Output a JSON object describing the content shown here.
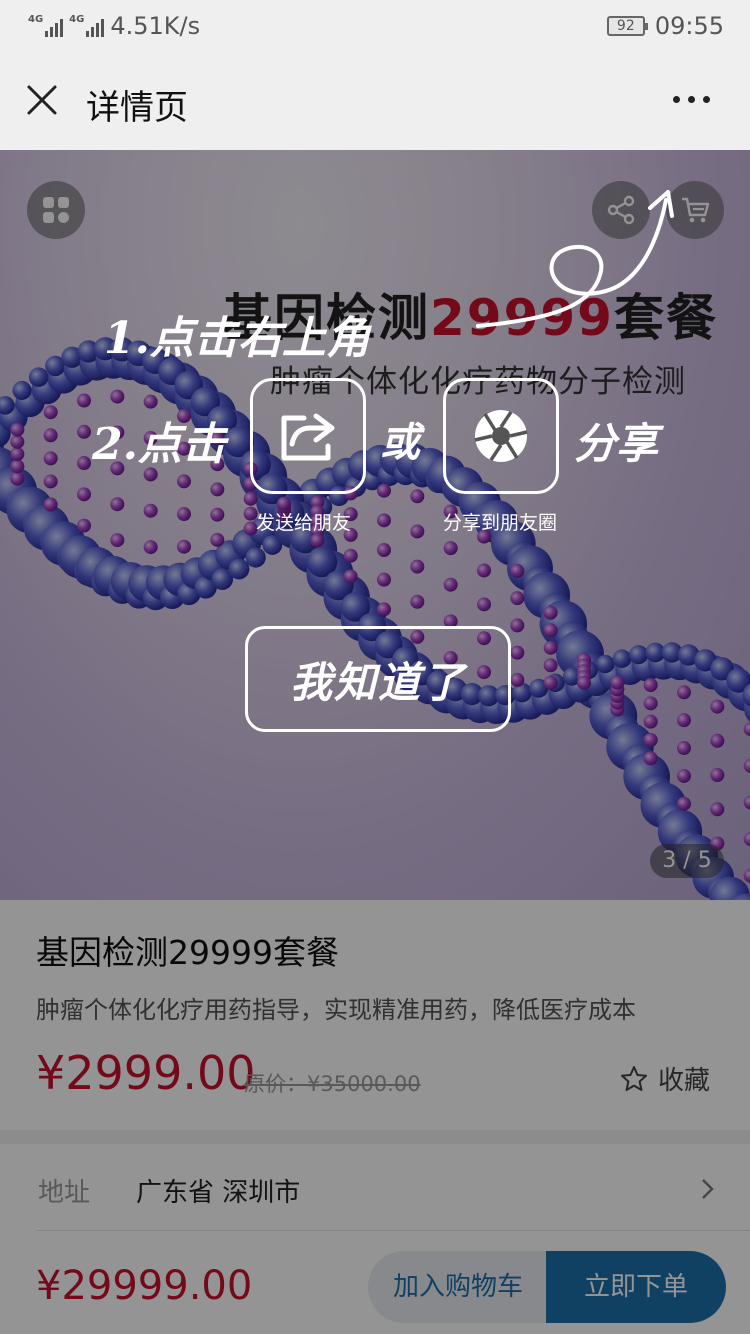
{
  "status_bar": {
    "network_1": "4G",
    "network_2": "4G",
    "speed": "4.51K/s",
    "battery": "92",
    "time": "09:55"
  },
  "nav": {
    "title": "详情页",
    "close_icon": "close-icon",
    "more_icon": "more-icon"
  },
  "hero": {
    "title_prefix": "基因检测",
    "title_number": "29999",
    "title_suffix": "套餐",
    "subtitle": "肿瘤个体化化疗药物分子检测",
    "page_indicator": "3 / 5"
  },
  "product": {
    "title": "基因检测29999套餐",
    "description": "肿瘤个体化化疗用药指导，实现精准用药，降低医疗成本",
    "price": "¥2999.00",
    "original_price": "原价：¥35000.00",
    "favorite_label": "收藏"
  },
  "address": {
    "label": "地址",
    "value": "广东省 深圳市"
  },
  "bottom_bar": {
    "price": "¥29999.00",
    "add_to_cart": "加入购物车",
    "buy_now": "立即下单"
  },
  "guide": {
    "step1": "1.点击右上角",
    "step2": "2.点击",
    "or": "或",
    "share": "分享",
    "send_to_friend": "发送给朋友",
    "share_to_moments": "分享到朋友圈",
    "got_it": "我知道了"
  },
  "colors": {
    "price_red": "#c8102e",
    "brand_blue": "#1c6fa9",
    "nav_bg": "#efefef"
  }
}
